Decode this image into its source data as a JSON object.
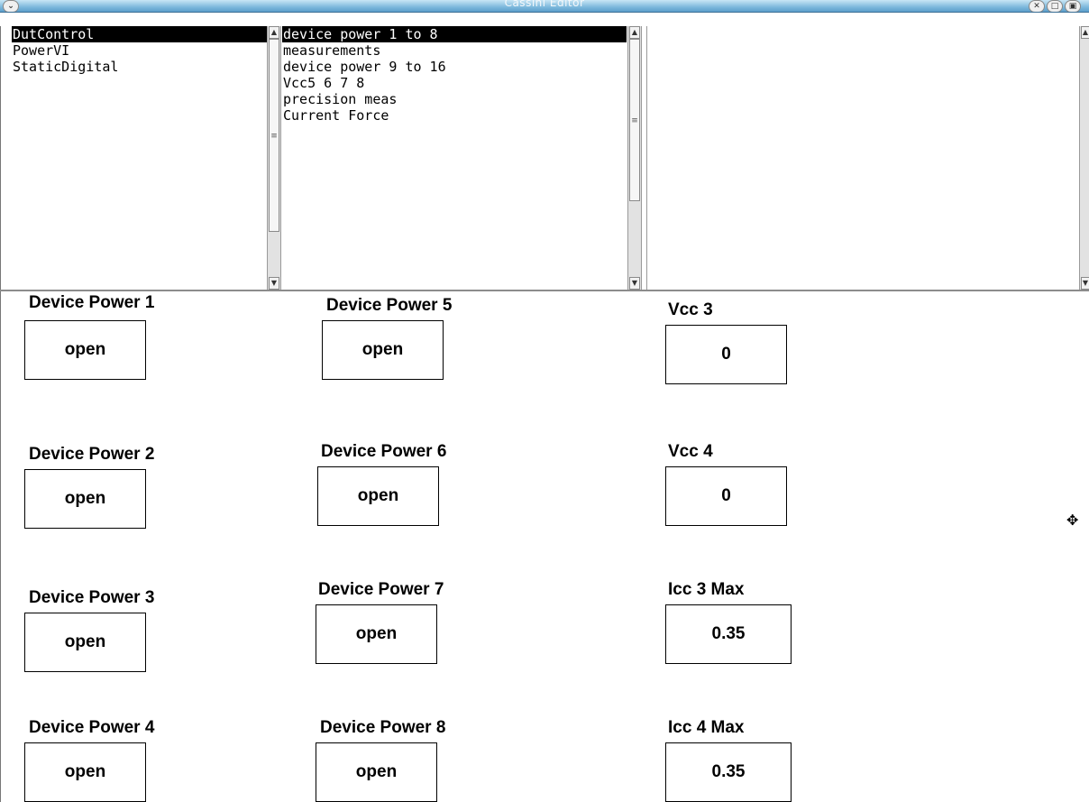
{
  "window": {
    "title": "Cassini Editor"
  },
  "list1": {
    "items": [
      "DutControl",
      "PowerVI",
      "StaticDigital"
    ],
    "selected_index": 0
  },
  "list2": {
    "items": [
      "device power 1 to 8",
      "measurements",
      "device power 9 to 16",
      "Vcc5 6 7 8",
      "precision meas",
      "Current Force"
    ],
    "selected_index": 0
  },
  "form": {
    "fields": [
      {
        "label": "Device Power 1",
        "value": "open"
      },
      {
        "label": "Device Power 2",
        "value": "open"
      },
      {
        "label": "Device Power 3",
        "value": "open"
      },
      {
        "label": "Device Power 4",
        "value": "open"
      },
      {
        "label": "Device Power 5",
        "value": "open"
      },
      {
        "label": "Device Power 6",
        "value": "open"
      },
      {
        "label": "Device Power 7",
        "value": "open"
      },
      {
        "label": "Device Power 8",
        "value": "open"
      },
      {
        "label": "Vcc 3",
        "value": "0"
      },
      {
        "label": "Vcc 4",
        "value": "0"
      },
      {
        "label": "Icc 3 Max",
        "value": "0.35"
      },
      {
        "label": "Icc 4 Max",
        "value": "0.35"
      }
    ]
  },
  "icons": {
    "menu": "chevron-down-icon",
    "close": "close-icon",
    "minimize": "minimize-icon",
    "maximize": "maximize-icon",
    "cursor": "crosshair-cursor-icon"
  },
  "colors": {
    "titlebar": "#7db9dc",
    "selection": "#000000"
  }
}
